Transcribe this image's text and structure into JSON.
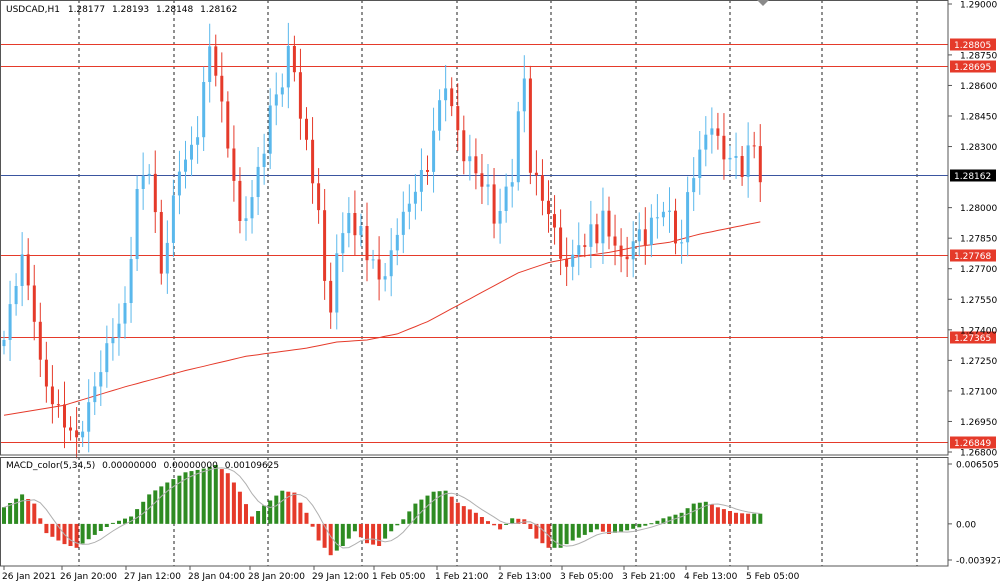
{
  "symbol_info": {
    "symbol": "USDCAD,H1",
    "open": "1.28177",
    "high": "1.28193",
    "low": "1.28148",
    "close": "1.28162"
  },
  "macd_info": {
    "label": "MACD_color(5,34,5)",
    "v1": "0.00000000",
    "v2": "0.00000000",
    "v3": "0.00109625"
  },
  "colors": {
    "bull": "#5AB8EC",
    "bear": "#E53A2A",
    "ma": "#E53A2A",
    "level_line": "#E53A2A",
    "price_line": "#3A55A0",
    "macd_up": "#2E8B22",
    "macd_down": "#E53A2A",
    "signal": "#B0B0B0"
  },
  "chart_data": [
    {
      "type": "candlestick",
      "price_axis": {
        "ylim": [
          1.268,
          1.29
        ],
        "ticks": [
          "1.29000",
          "1.28750",
          "1.28600",
          "1.28450",
          "1.28300",
          "1.28000",
          "1.27850",
          "1.27700",
          "1.27550",
          "1.27400",
          "1.27250",
          "1.27100",
          "1.26950",
          "1.26800"
        ]
      },
      "level_lines": [
        {
          "value": 1.28805,
          "label": "1.28805"
        },
        {
          "value": 1.28695,
          "label": "1.28695"
        },
        {
          "value": 1.27768,
          "label": "1.27768"
        },
        {
          "value": 1.27365,
          "label": "1.27365"
        },
        {
          "value": 1.26849,
          "label": "1.26849"
        }
      ],
      "current_price": {
        "value": 1.28162,
        "label": "1.28162"
      },
      "time_labels": [
        "26 Jan 2021",
        "26 Jan 20:00",
        "27 Jan 12:00",
        "28 Jan 04:00",
        "28 Jan 20:00",
        "29 Jan 12:00",
        "1 Feb 05:00",
        "1 Feb 21:00",
        "2 Feb 13:00",
        "3 Feb 05:00",
        "3 Feb 21:00",
        "4 Feb 13:00",
        "5 Feb 05:00"
      ],
      "path_points": [
        [
          0,
          1.2735
        ],
        [
          2,
          1.2765
        ],
        [
          3,
          1.2775
        ],
        [
          5,
          1.2747
        ],
        [
          6,
          1.2722
        ],
        [
          8,
          1.2705
        ],
        [
          10,
          1.2695
        ],
        [
          11,
          1.269
        ],
        [
          12,
          1.2685
        ],
        [
          14,
          1.2702
        ],
        [
          16,
          1.2722
        ],
        [
          18,
          1.2738
        ],
        [
          20,
          1.275
        ],
        [
          21,
          1.2778
        ],
        [
          22,
          1.2808
        ],
        [
          24,
          1.282
        ],
        [
          25,
          1.2795
        ],
        [
          26,
          1.2768
        ],
        [
          27,
          1.2785
        ],
        [
          29,
          1.282
        ],
        [
          31,
          1.2828
        ],
        [
          32,
          1.2838
        ],
        [
          33,
          1.286
        ],
        [
          34,
          1.2878
        ],
        [
          35,
          1.2868
        ],
        [
          37,
          1.283
        ],
        [
          38,
          1.2815
        ],
        [
          39,
          1.279
        ],
        [
          41,
          1.2805
        ],
        [
          43,
          1.283
        ],
        [
          44,
          1.2848
        ],
        [
          46,
          1.2862
        ],
        [
          47,
          1.2876
        ],
        [
          48,
          1.2868
        ],
        [
          49,
          1.2845
        ],
        [
          51,
          1.2815
        ],
        [
          52,
          1.2798
        ],
        [
          53,
          1.2762
        ],
        [
          54,
          1.2752
        ],
        [
          55,
          1.2775
        ],
        [
          57,
          1.28
        ],
        [
          58,
          1.2783
        ],
        [
          59,
          1.2793
        ],
        [
          60,
          1.2775
        ],
        [
          62,
          1.2768
        ],
        [
          63,
          1.2765
        ],
        [
          65,
          1.279
        ],
        [
          66,
          1.2795
        ],
        [
          68,
          1.281
        ],
        [
          70,
          1.282
        ],
        [
          71,
          1.2838
        ],
        [
          72,
          1.285
        ],
        [
          73,
          1.2862
        ],
        [
          74,
          1.2848
        ],
        [
          76,
          1.2826
        ],
        [
          77,
          1.2822
        ],
        [
          78,
          1.2818
        ],
        [
          79,
          1.2812
        ],
        [
          80,
          1.2808
        ],
        [
          81,
          1.2795
        ],
        [
          82,
          1.2798
        ],
        [
          83,
          1.2808
        ],
        [
          84,
          1.2816
        ],
        [
          85,
          1.2845
        ],
        [
          86,
          1.2863
        ],
        [
          87,
          1.282
        ],
        [
          89,
          1.2805
        ],
        [
          90,
          1.2798
        ],
        [
          91,
          1.2787
        ],
        [
          92,
          1.2778
        ],
        [
          93,
          1.277
        ],
        [
          94,
          1.2775
        ],
        [
          95,
          1.2785
        ],
        [
          96,
          1.2778
        ],
        [
          97,
          1.2792
        ],
        [
          98,
          1.2785
        ],
        [
          99,
          1.2795
        ],
        [
          100,
          1.2788
        ],
        [
          101,
          1.2782
        ],
        [
          102,
          1.2773
        ],
        [
          103,
          1.2778
        ],
        [
          104,
          1.2782
        ],
        [
          105,
          1.2788
        ],
        [
          106,
          1.2785
        ],
        [
          107,
          1.2792
        ],
        [
          109,
          1.28
        ],
        [
          110,
          1.2795
        ],
        [
          111,
          1.2785
        ],
        [
          112,
          1.2783
        ],
        [
          113,
          1.2805
        ],
        [
          114,
          1.2818
        ],
        [
          116,
          1.2835
        ],
        [
          117,
          1.2842
        ],
        [
          118,
          1.2832
        ],
        [
          119,
          1.2825
        ],
        [
          120,
          1.2826
        ],
        [
          121,
          1.2822
        ],
        [
          122,
          1.2818
        ],
        [
          123,
          1.283
        ],
        [
          124,
          1.2828
        ],
        [
          125,
          1.2816
        ]
      ],
      "ma_points": [
        [
          0,
          1.2698
        ],
        [
          10,
          1.2703
        ],
        [
          20,
          1.2712
        ],
        [
          30,
          1.272
        ],
        [
          40,
          1.2727
        ],
        [
          50,
          1.2731
        ],
        [
          55,
          1.2734
        ],
        [
          60,
          1.2735
        ],
        [
          65,
          1.2738
        ],
        [
          70,
          1.2744
        ],
        [
          75,
          1.2752
        ],
        [
          80,
          1.276
        ],
        [
          85,
          1.2768
        ],
        [
          90,
          1.2773
        ],
        [
          95,
          1.2776
        ],
        [
          100,
          1.2778
        ],
        [
          105,
          1.2781
        ],
        [
          110,
          1.2783
        ],
        [
          115,
          1.2787
        ],
        [
          120,
          1.279
        ],
        [
          125,
          1.2793
        ]
      ]
    },
    {
      "type": "bar",
      "name": "MACD_color(5,34,5)",
      "ylim": [
        -0.003927,
        0.006505
      ],
      "ticks": [
        "0.006505",
        "0.00",
        "-0.003927"
      ],
      "histogram_points": [
        [
          0,
          0.0018
        ],
        [
          3,
          0.0032
        ],
        [
          5,
          0.0022
        ],
        [
          7,
          -0.001
        ],
        [
          10,
          -0.0022
        ],
        [
          12,
          -0.0026
        ],
        [
          15,
          -0.0012
        ],
        [
          18,
          0.0001
        ],
        [
          21,
          0.0008
        ],
        [
          24,
          0.0032
        ],
        [
          27,
          0.0045
        ],
        [
          30,
          0.0056
        ],
        [
          33,
          0.006
        ],
        [
          35,
          0.0064
        ],
        [
          37,
          0.0055
        ],
        [
          39,
          0.0035
        ],
        [
          41,
          0.0008
        ],
        [
          43,
          0.002
        ],
        [
          46,
          0.0036
        ],
        [
          48,
          0.0034
        ],
        [
          50,
          0.0012
        ],
        [
          52,
          -0.0018
        ],
        [
          54,
          -0.0034
        ],
        [
          56,
          -0.0024
        ],
        [
          58,
          -0.0008
        ],
        [
          60,
          -0.0021
        ],
        [
          62,
          -0.0024
        ],
        [
          64,
          -0.0008
        ],
        [
          66,
          0.0005
        ],
        [
          68,
          0.0022
        ],
        [
          71,
          0.0035
        ],
        [
          73,
          0.0036
        ],
        [
          75,
          0.0023
        ],
        [
          78,
          0.0012
        ],
        [
          80,
          0.0003
        ],
        [
          82,
          -0.0006
        ],
        [
          84,
          0.0006
        ],
        [
          86,
          0.0005
        ],
        [
          88,
          -0.0016
        ],
        [
          90,
          -0.0026
        ],
        [
          92,
          -0.0026
        ],
        [
          94,
          -0.0018
        ],
        [
          96,
          -0.0012
        ],
        [
          98,
          -0.0006
        ],
        [
          100,
          -0.0011
        ],
        [
          103,
          -0.0007
        ],
        [
          106,
          -0.0002
        ],
        [
          109,
          0.0006
        ],
        [
          112,
          0.0012
        ],
        [
          114,
          0.0022
        ],
        [
          116,
          0.0024
        ],
        [
          118,
          0.0018
        ],
        [
          121,
          0.0012
        ],
        [
          123,
          0.0011
        ],
        [
          125,
          0.0011
        ]
      ]
    }
  ]
}
